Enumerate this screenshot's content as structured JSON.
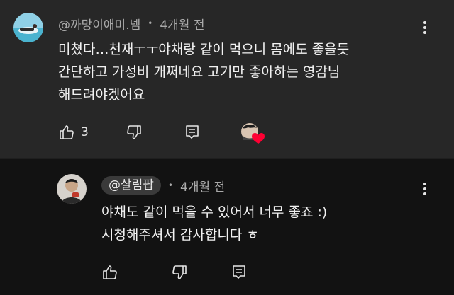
{
  "comments": [
    {
      "author": "@까망이애미.넴",
      "time": "4개월 전",
      "lines": [
        "미쳤다…천재ㅜㅜ야채랑 같이 먹으니 몸에도 좋을듯",
        "간단하고 가성비 개쩌네요 고기만 좋아하는 영감님",
        "해드려야겠어요"
      ],
      "like_count": "3",
      "icons": {
        "like": "thumbs-up-icon",
        "dislike": "thumbs-down-icon",
        "reply": "reply-icon",
        "more": "more-vertical-icon",
        "creator_heart": "creator-heart-icon"
      }
    },
    {
      "author": "@살림팝",
      "time": "4개월 전",
      "lines": [
        "야채도 같이 먹을 수 있어서 너무 좋죠 :)",
        "시청해주셔서 감사합니다 ㅎ"
      ],
      "like_count": "",
      "icons": {
        "like": "thumbs-up-icon",
        "dislike": "thumbs-down-icon",
        "reply": "reply-icon",
        "more": "more-vertical-icon"
      }
    }
  ],
  "colors": {
    "comment_bg": "#272727",
    "reply_bg": "#121212",
    "text": "#f1f1f1",
    "meta": "#aaaaaa",
    "heart": "#ff0033"
  }
}
